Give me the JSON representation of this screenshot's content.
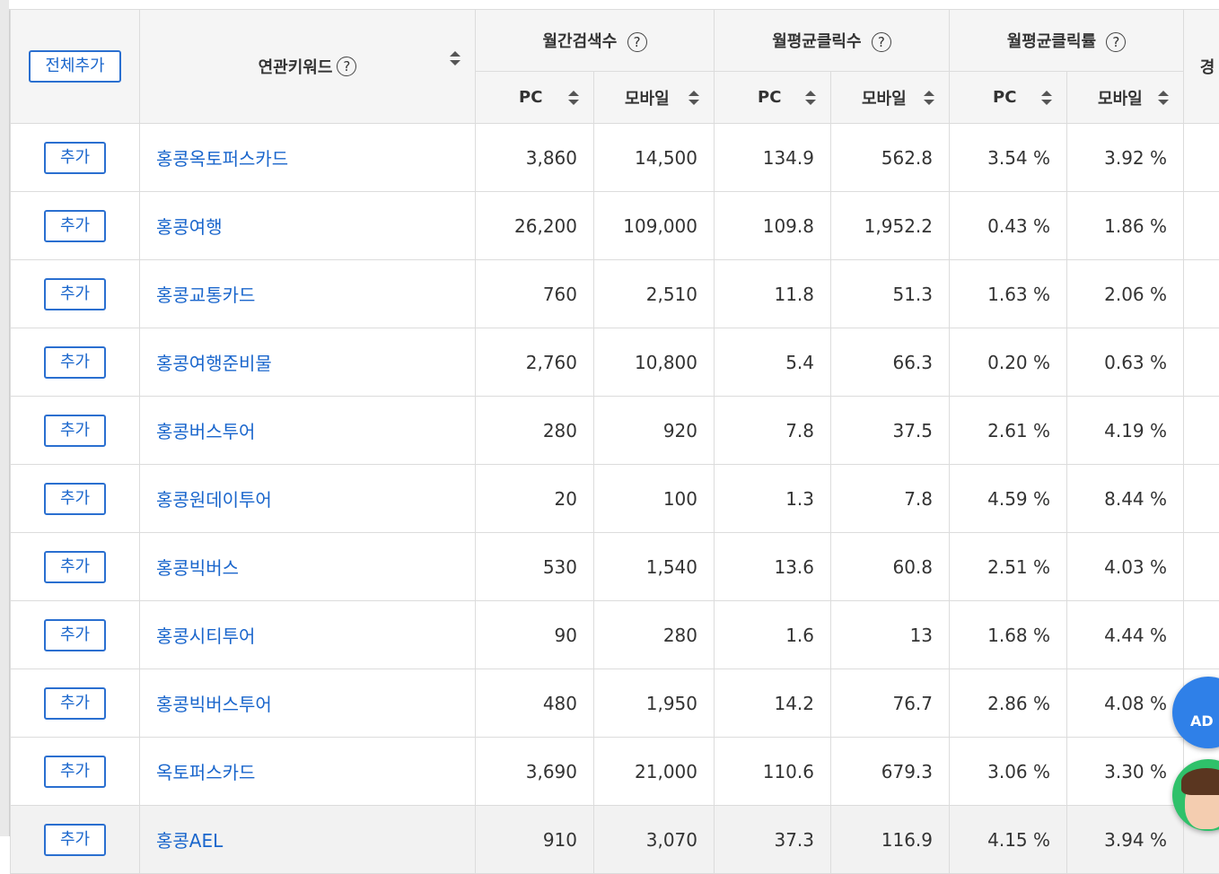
{
  "header": {
    "add_all": "전체추가",
    "keyword_col": "연관키워드",
    "groups": [
      "월간검색수",
      "월평균클릭수",
      "월평균클릭률"
    ],
    "next_group_partial": "경",
    "pc": "PC",
    "mobile": "모바일",
    "help_glyph": "?"
  },
  "add_label": "추가",
  "rows": [
    {
      "keyword": "홍콩옥토퍼스카드",
      "search_pc": "3,860",
      "search_mobile": "14,500",
      "click_pc": "134.9",
      "click_mobile": "562.8",
      "ctr_pc": "3.54 %",
      "ctr_mobile": "3.92 %"
    },
    {
      "keyword": "홍콩여행",
      "search_pc": "26,200",
      "search_mobile": "109,000",
      "click_pc": "109.8",
      "click_mobile": "1,952.2",
      "ctr_pc": "0.43 %",
      "ctr_mobile": "1.86 %"
    },
    {
      "keyword": "홍콩교통카드",
      "search_pc": "760",
      "search_mobile": "2,510",
      "click_pc": "11.8",
      "click_mobile": "51.3",
      "ctr_pc": "1.63 %",
      "ctr_mobile": "2.06 %"
    },
    {
      "keyword": "홍콩여행준비물",
      "search_pc": "2,760",
      "search_mobile": "10,800",
      "click_pc": "5.4",
      "click_mobile": "66.3",
      "ctr_pc": "0.20 %",
      "ctr_mobile": "0.63 %"
    },
    {
      "keyword": "홍콩버스투어",
      "search_pc": "280",
      "search_mobile": "920",
      "click_pc": "7.8",
      "click_mobile": "37.5",
      "ctr_pc": "2.61 %",
      "ctr_mobile": "4.19 %"
    },
    {
      "keyword": "홍콩원데이투어",
      "search_pc": "20",
      "search_mobile": "100",
      "click_pc": "1.3",
      "click_mobile": "7.8",
      "ctr_pc": "4.59 %",
      "ctr_mobile": "8.44 %"
    },
    {
      "keyword": "홍콩빅버스",
      "search_pc": "530",
      "search_mobile": "1,540",
      "click_pc": "13.6",
      "click_mobile": "60.8",
      "ctr_pc": "2.51 %",
      "ctr_mobile": "4.03 %"
    },
    {
      "keyword": "홍콩시티투어",
      "search_pc": "90",
      "search_mobile": "280",
      "click_pc": "1.6",
      "click_mobile": "13",
      "ctr_pc": "1.68 %",
      "ctr_mobile": "4.44 %"
    },
    {
      "keyword": "홍콩빅버스투어",
      "search_pc": "480",
      "search_mobile": "1,950",
      "click_pc": "14.2",
      "click_mobile": "76.7",
      "ctr_pc": "2.86 %",
      "ctr_mobile": "4.08 %"
    },
    {
      "keyword": "옥토퍼스카드",
      "search_pc": "3,690",
      "search_mobile": "21,000",
      "click_pc": "110.6",
      "click_mobile": "679.3",
      "ctr_pc": "3.06 %",
      "ctr_mobile": "3.30 %"
    },
    {
      "keyword": "홍콩AEL",
      "search_pc": "910",
      "search_mobile": "3,070",
      "click_pc": "37.3",
      "click_mobile": "116.9",
      "ctr_pc": "4.15 %",
      "ctr_mobile": "3.94 %"
    }
  ],
  "floating": {
    "ad_badge": "AD",
    "ad_icon": "ad-shortcut-icon",
    "chat_icon": "chat-avatar-icon"
  }
}
